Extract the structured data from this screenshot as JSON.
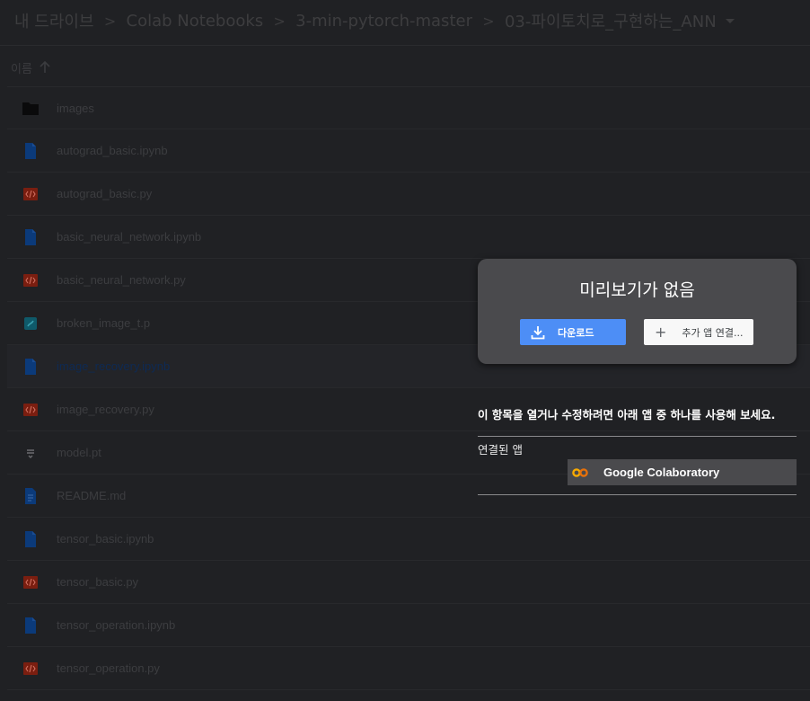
{
  "breadcrumb": {
    "items": [
      "내 드라이브",
      "Colab Notebooks",
      "3-min-pytorch-master",
      "03-파이토치로_구현하는_ANN"
    ],
    "separator": ">"
  },
  "columns": {
    "name_header": "이름",
    "sort": "ascending"
  },
  "files": [
    {
      "name": "images",
      "icon": "folder-icon",
      "type": "folder"
    },
    {
      "name": "autograd_basic.ipynb",
      "icon": "document-icon",
      "type": "ipynb"
    },
    {
      "name": "autograd_basic.py",
      "icon": "code-file-icon",
      "type": "py"
    },
    {
      "name": "basic_neural_network.ipynb",
      "icon": "document-icon",
      "type": "ipynb"
    },
    {
      "name": "basic_neural_network.py",
      "icon": "code-file-icon",
      "type": "py"
    },
    {
      "name": "broken_image_t.p",
      "icon": "generic-file-icon",
      "type": "p"
    },
    {
      "name": "image_recovery.ipynb",
      "icon": "document-icon",
      "type": "ipynb",
      "selected": true
    },
    {
      "name": "image_recovery.py",
      "icon": "code-file-icon",
      "type": "py"
    },
    {
      "name": "model.pt",
      "icon": "binary-file-icon",
      "type": "pt"
    },
    {
      "name": "README.md",
      "icon": "text-document-icon",
      "type": "md"
    },
    {
      "name": "tensor_basic.ipynb",
      "icon": "document-icon",
      "type": "ipynb"
    },
    {
      "name": "tensor_basic.py",
      "icon": "code-file-icon",
      "type": "py"
    },
    {
      "name": "tensor_operation.ipynb",
      "icon": "document-icon",
      "type": "ipynb"
    },
    {
      "name": "tensor_operation.py",
      "icon": "code-file-icon",
      "type": "py"
    }
  ],
  "preview": {
    "title": "미리보기가 없음",
    "download_label": "다운로드",
    "connect_label": "추가 앱 연결..."
  },
  "open_with": {
    "hint": "이 항목을 열거나 수정하려면 아래 앱 중 하나를 사용해 보세요.",
    "connected_label": "연결된 앱",
    "apps": [
      {
        "name": "Google Colaboratory",
        "icon": "colab-logo-icon"
      }
    ]
  },
  "colors": {
    "background": "#202124",
    "card": "#4a4a4d",
    "primary_button": "#4d8ef6",
    "doc_icon": "#0b3a7a",
    "code_icon": "#7a1e10",
    "colab_orange": "#f9ab00"
  }
}
